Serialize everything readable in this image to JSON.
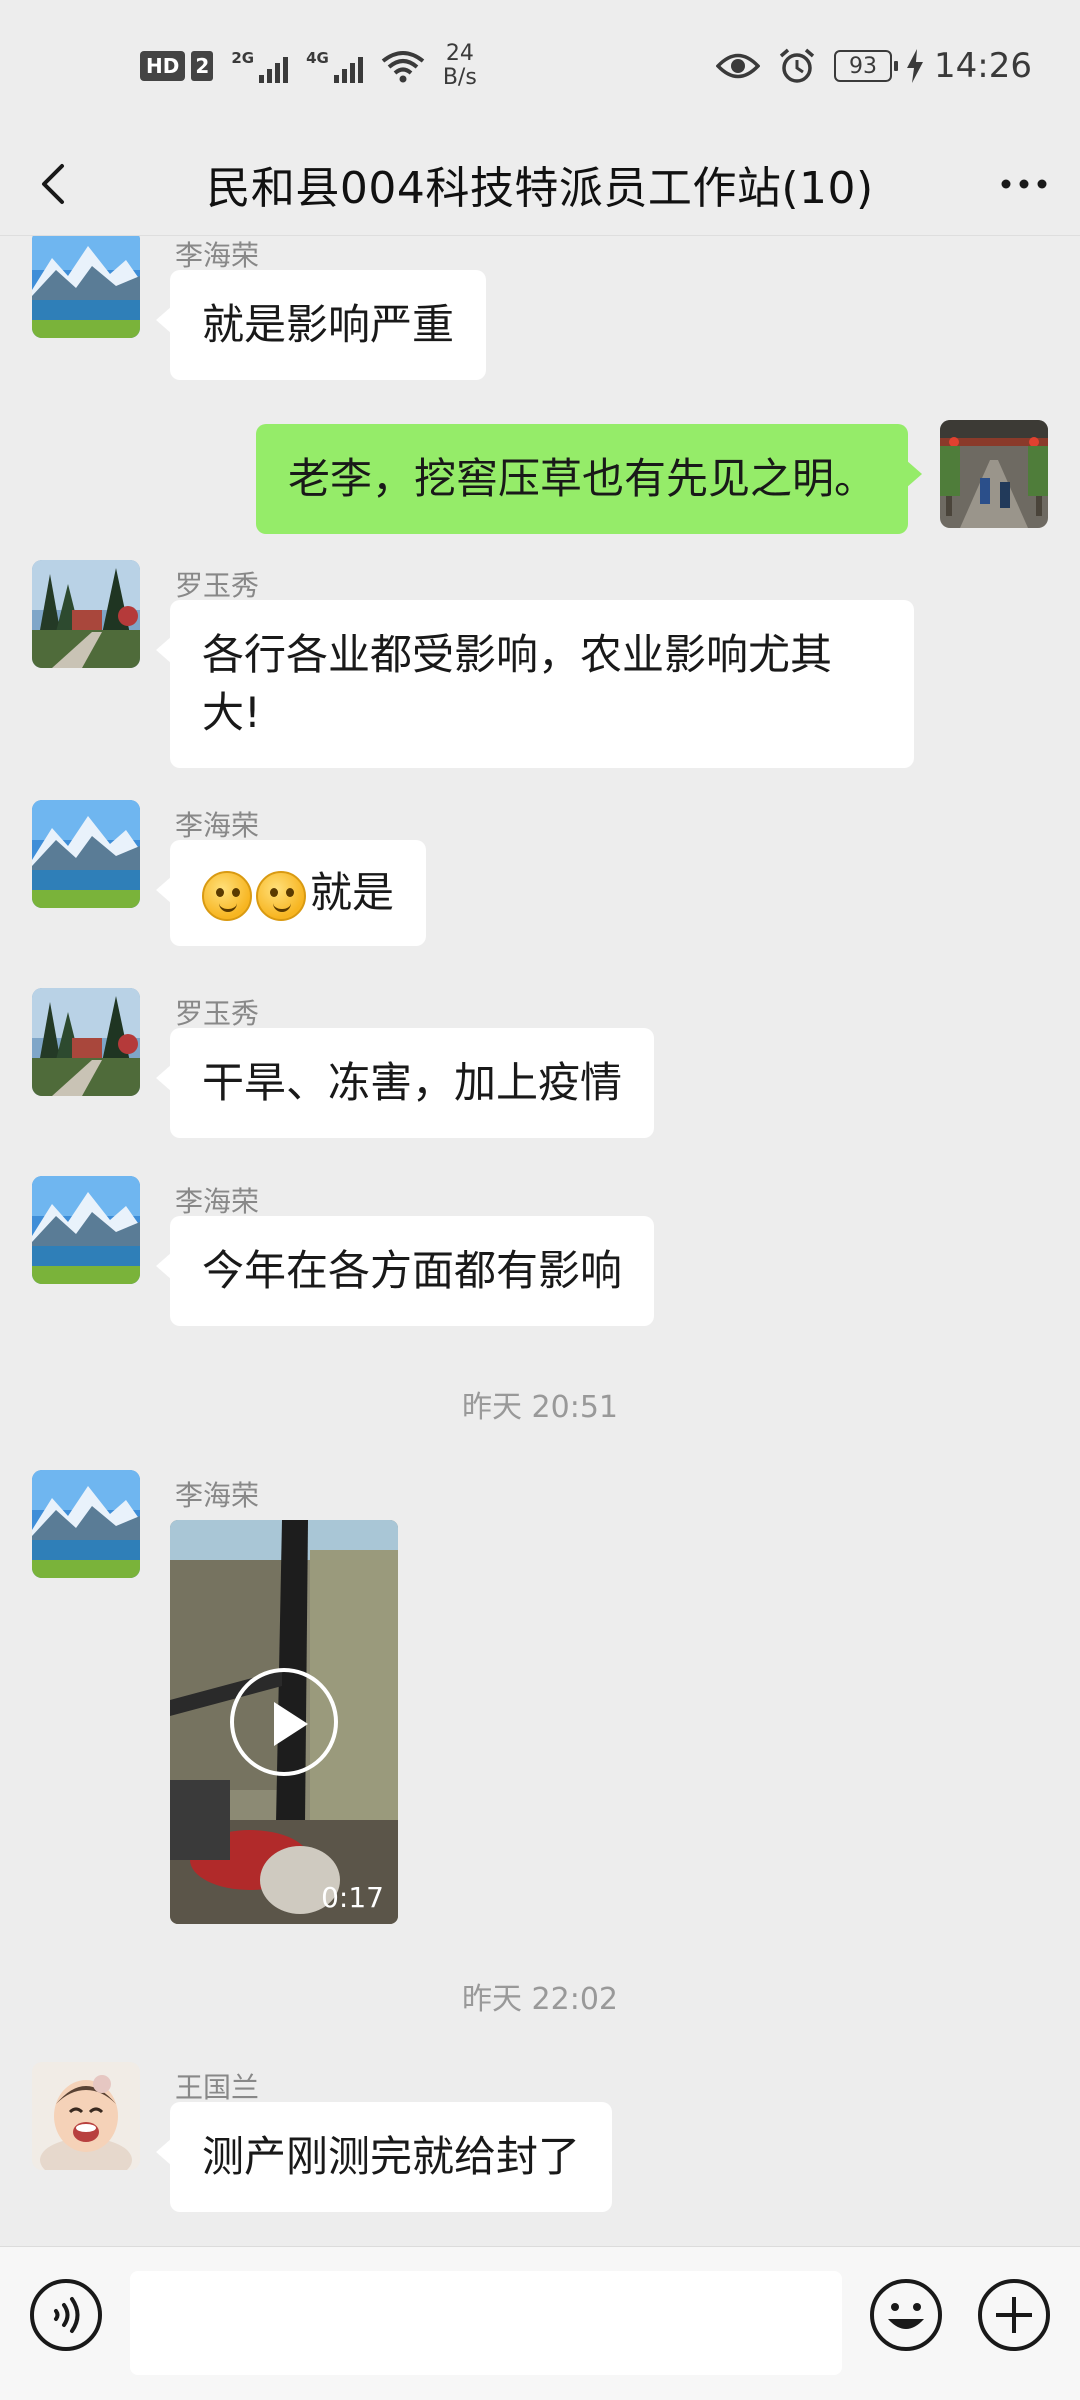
{
  "status_bar": {
    "hd": "HD",
    "sim": "2",
    "net1": "2G",
    "net2": "4G",
    "speed_value": "24",
    "speed_unit": "B/s",
    "battery": "93",
    "time": "14:26",
    "icons": [
      "eye-icon",
      "alarm-icon",
      "charging-icon",
      "wifi-icon"
    ]
  },
  "header": {
    "title": "民和县004科技特派员工作站(10)"
  },
  "messages": [
    {
      "sender": "李海荣",
      "text": "就是影响严重"
    },
    {
      "sender": "",
      "text": "老李，挖窖压草也有先见之明。"
    },
    {
      "sender": "罗玉秀",
      "text_line1": "各行各业都受影响，农业影响尤其",
      "text_line2": "大!"
    },
    {
      "sender": "李海荣",
      "text": "就是"
    },
    {
      "sender": "罗玉秀",
      "text": "干旱、冻害，加上疫情"
    },
    {
      "sender": "李海荣",
      "text": "今年在各方面都有影响"
    },
    {
      "sender": "李海荣",
      "video_duration": "0:17"
    },
    {
      "sender": "王国兰",
      "text": "测产刚测完就给封了"
    }
  ],
  "timestamps": [
    "昨天 20:51",
    "昨天 22:02"
  ],
  "colors": {
    "background": "#ededed",
    "my_bubble": "#95ec69",
    "other_bubble": "#ffffff"
  }
}
